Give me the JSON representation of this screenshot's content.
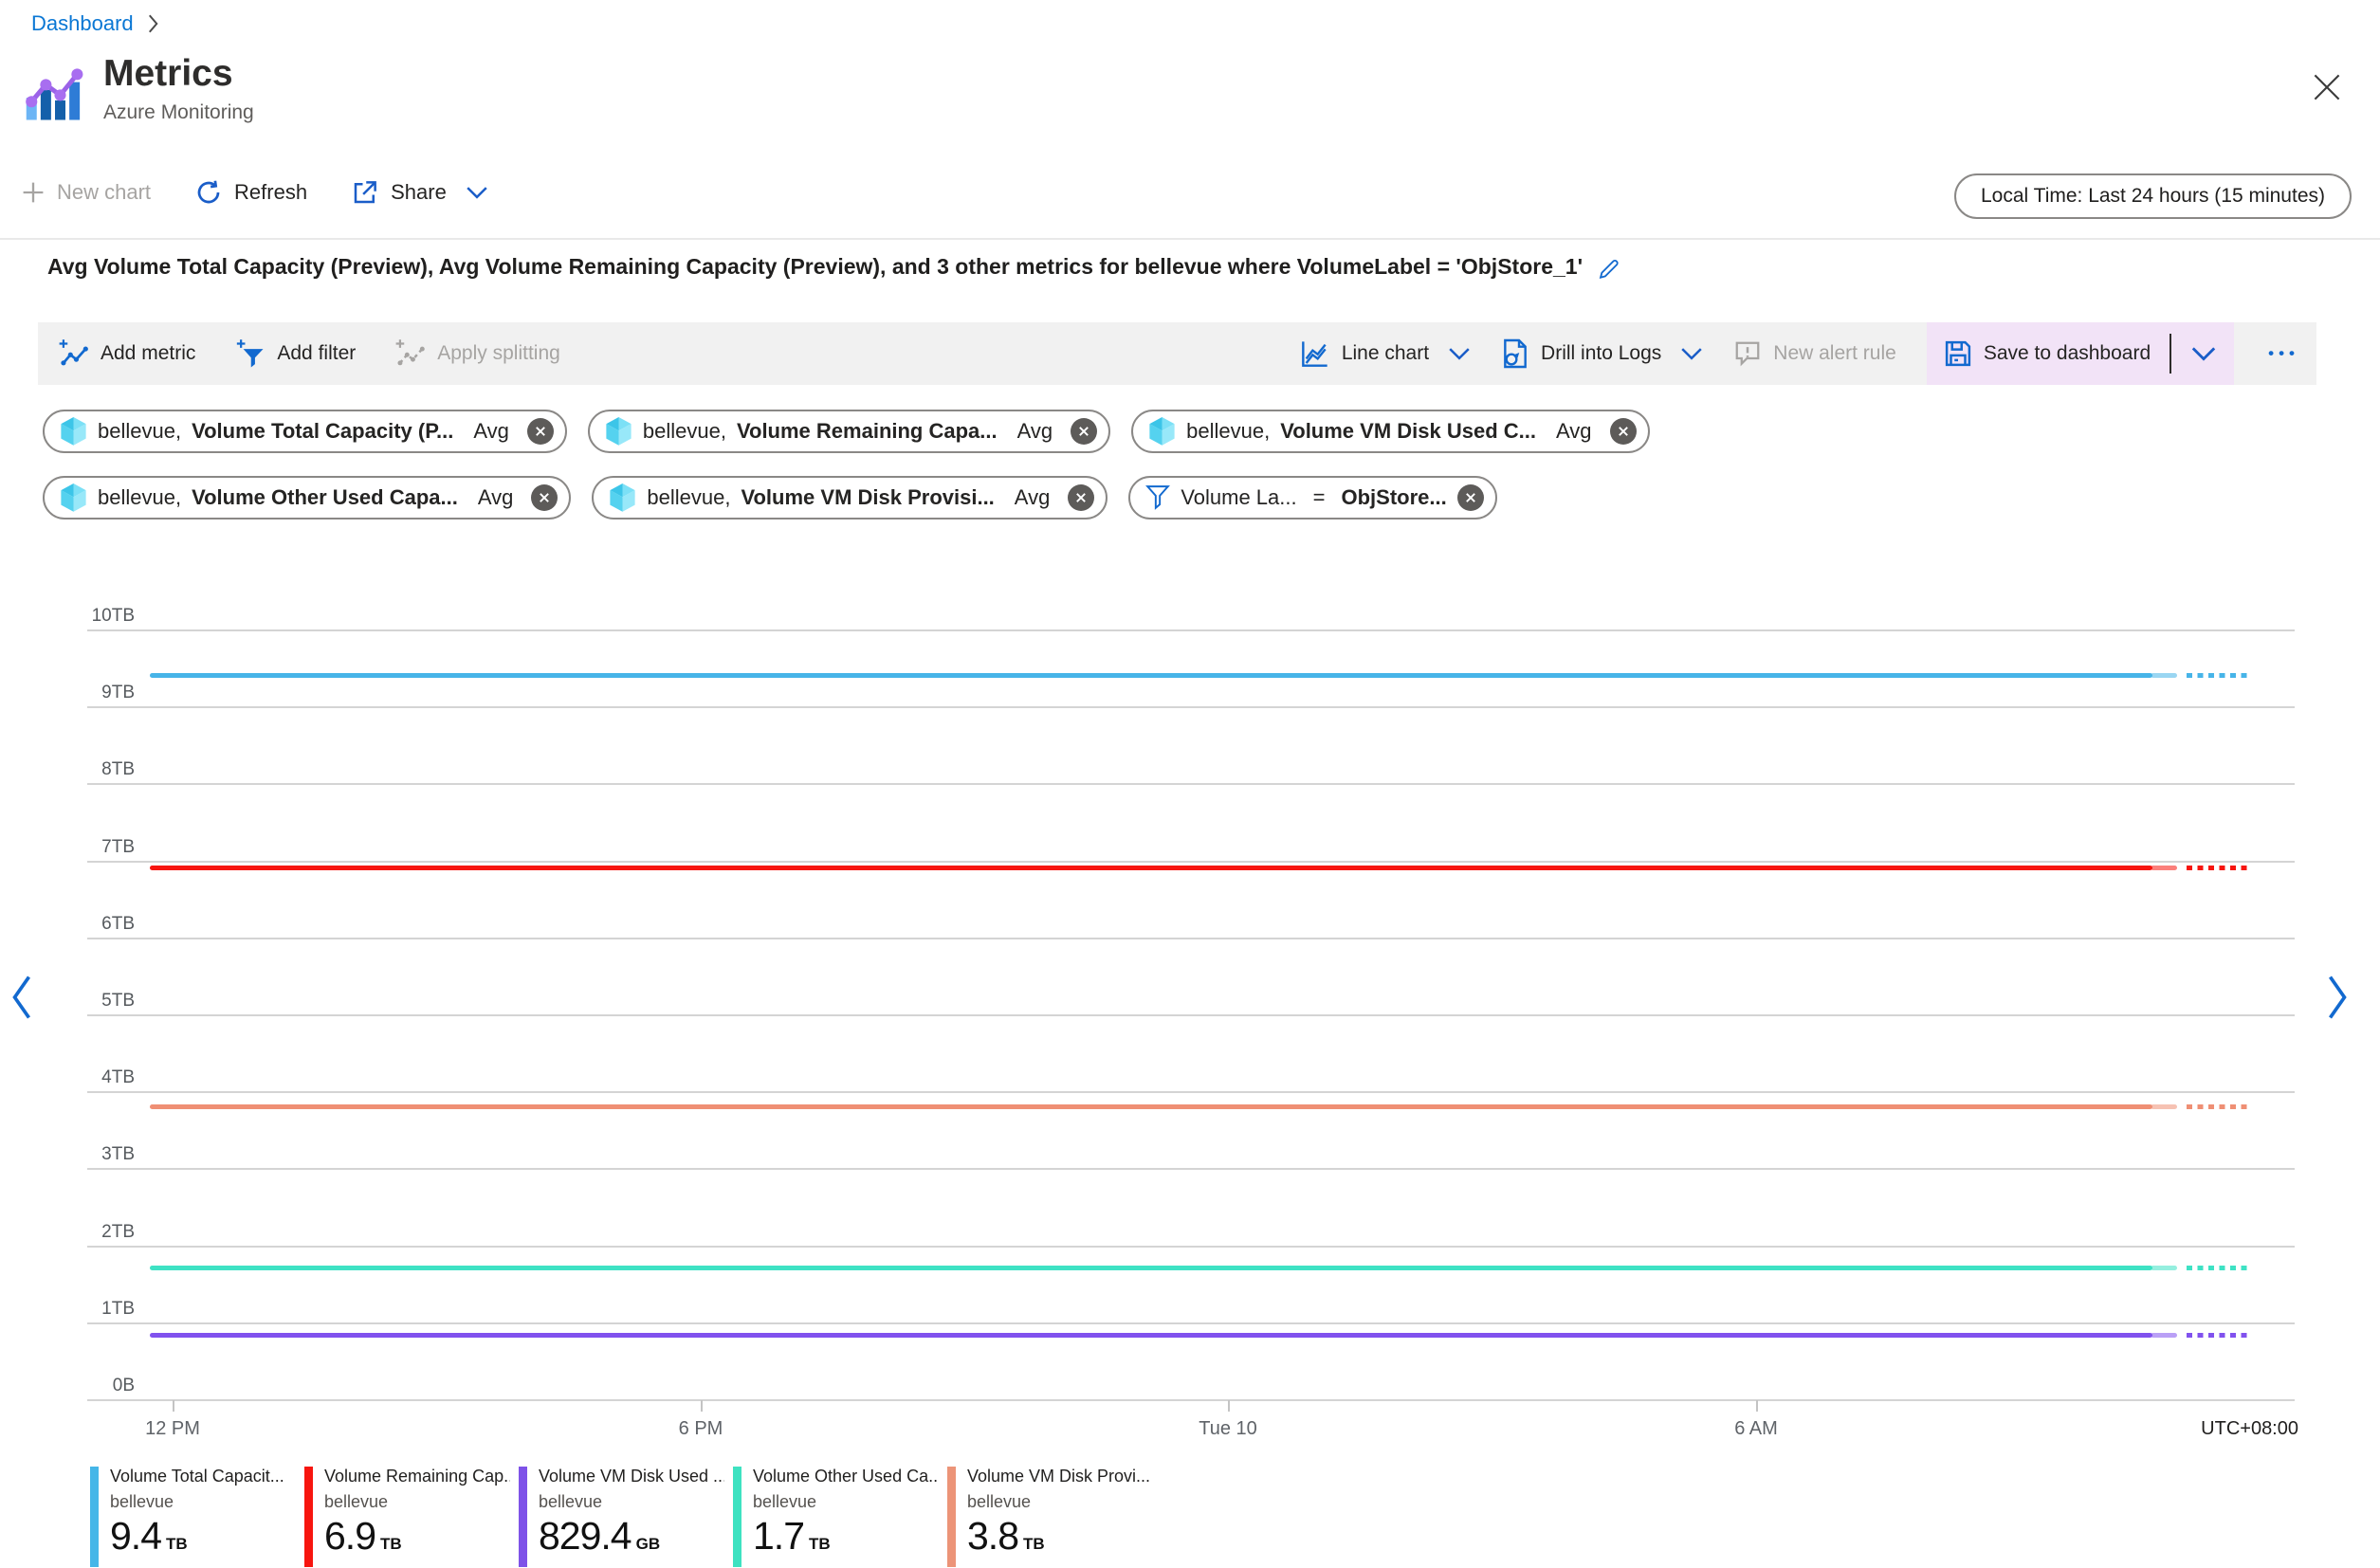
{
  "breadcrumb": {
    "dashboard": "Dashboard"
  },
  "header": {
    "title": "Metrics",
    "subtitle": "Azure Monitoring"
  },
  "command_bar": {
    "new_chart": "New chart",
    "refresh": "Refresh",
    "share": "Share",
    "time_range": "Local Time: Last 24 hours (15 minutes)"
  },
  "chart_header": {
    "title": "Avg Volume Total Capacity (Preview), Avg Volume Remaining Capacity (Preview), and 3 other metrics for bellevue where VolumeLabel = 'ObjStore_1'"
  },
  "toolbar": {
    "add_metric": "Add metric",
    "add_filter": "Add filter",
    "apply_splitting": "Apply splitting",
    "line_chart": "Line chart",
    "drill_into_logs": "Drill into Logs",
    "new_alert_rule": "New alert rule",
    "save_to_dashboard": "Save to dashboard"
  },
  "pills": [
    {
      "type": "metric",
      "scope": "bellevue,",
      "metric": "Volume Total Capacity (P...",
      "aggregation": "Avg"
    },
    {
      "type": "metric",
      "scope": "bellevue,",
      "metric": "Volume Remaining Capa...",
      "aggregation": "Avg"
    },
    {
      "type": "metric",
      "scope": "bellevue,",
      "metric": "Volume VM Disk Used C...",
      "aggregation": "Avg"
    },
    {
      "type": "metric",
      "scope": "bellevue,",
      "metric": "Volume Other Used Capa...",
      "aggregation": "Avg"
    },
    {
      "type": "metric",
      "scope": "bellevue,",
      "metric": "Volume VM Disk Provisi...",
      "aggregation": "Avg"
    },
    {
      "type": "filter",
      "field": "Volume La...",
      "operator": "=",
      "value": "ObjStore..."
    }
  ],
  "chart_data": {
    "type": "line",
    "title": "Avg Volume Total Capacity (Preview), Avg Volume Remaining Capacity (Preview), and 3 other metrics for bellevue where VolumeLabel = 'ObjStore_1'",
    "y_ticks": [
      "10TB",
      "9TB",
      "8TB",
      "7TB",
      "6TB",
      "5TB",
      "4TB",
      "3TB",
      "2TB",
      "1TB",
      "0B"
    ],
    "x_ticks": [
      "12 PM",
      "6 PM",
      "Tue 10",
      "6 AM"
    ],
    "timezone_label": "UTC+08:00",
    "ylim_tb": [
      0,
      10
    ],
    "grid": true,
    "legend_position": "bottom",
    "series": [
      {
        "name": "Volume Total Capacity",
        "resource": "bellevue",
        "aggregation": "Avg",
        "value_tb": 9.4,
        "display_value": "9.4",
        "unit": "TB",
        "color": "#47b4e8"
      },
      {
        "name": "Volume Remaining Capacity",
        "resource": "bellevue",
        "aggregation": "Avg",
        "value_tb": 6.9,
        "display_value": "6.9",
        "unit": "TB",
        "color": "#f7150f"
      },
      {
        "name": "Volume VM Disk Provisioned",
        "resource": "bellevue",
        "aggregation": "Avg",
        "value_tb": 3.8,
        "display_value": "3.8",
        "unit": "TB",
        "color": "#ef8f74"
      },
      {
        "name": "Volume Other Used Capacity",
        "resource": "bellevue",
        "aggregation": "Avg",
        "value_tb": 1.7,
        "display_value": "1.7",
        "unit": "TB",
        "color": "#3ee2c4"
      },
      {
        "name": "Volume VM Disk Used Capacity",
        "resource": "bellevue",
        "aggregation": "Avg",
        "value_tb": 0.8294,
        "display_value": "829.4",
        "unit": "GB",
        "color": "#8152ee"
      }
    ]
  },
  "legend": [
    {
      "name": "Volume Total Capacit...",
      "resource": "bellevue",
      "value": "9.4",
      "unit": "TB",
      "color": "#45b6e8"
    },
    {
      "name": "Volume Remaining Cap...",
      "resource": "bellevue",
      "value": "6.9",
      "unit": "TB",
      "color": "#f7150f"
    },
    {
      "name": "Volume VM Disk Used ...",
      "resource": "bellevue",
      "value": "829.4",
      "unit": "GB",
      "color": "#7e52e8"
    },
    {
      "name": "Volume Other Used Ca...",
      "resource": "bellevue",
      "value": "1.7",
      "unit": "TB",
      "color": "#3ee2c1"
    },
    {
      "name": "Volume VM Disk Provi...",
      "resource": "bellevue",
      "value": "3.8",
      "unit": "TB",
      "color": "#ec9478"
    }
  ],
  "colors": {
    "breadcrumb_blue": "#0a77d4",
    "accent_blue": "#1269cf",
    "save_highlight": "#f2e3f7",
    "toolbar_bg": "#f1f1f1",
    "grid_line": "#d4d4d4",
    "disabled_text": "#a6a4a2"
  }
}
